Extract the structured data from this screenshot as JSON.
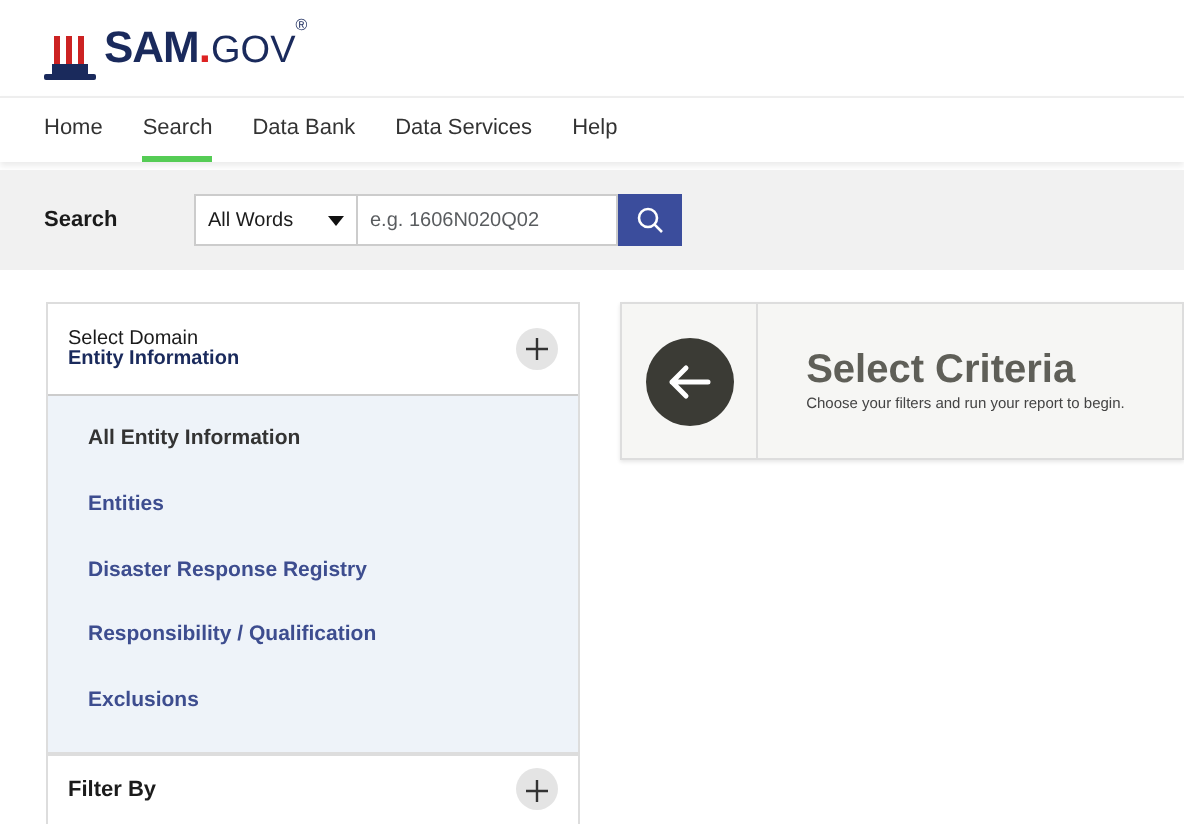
{
  "logo": {
    "name": "SAM",
    "dot": ".",
    "suffix": "GOV",
    "mark": "®"
  },
  "nav": [
    {
      "label": "Home",
      "selected": false
    },
    {
      "label": "Search",
      "selected": true
    },
    {
      "label": "Data Bank",
      "selected": false
    },
    {
      "label": "Data Services",
      "selected": false
    },
    {
      "label": "Help",
      "selected": false
    }
  ],
  "search": {
    "label": "Search",
    "scope": "All Words",
    "placeholder": "e.g. 1606N020Q02"
  },
  "domain": {
    "label": "Select Domain",
    "value": "Entity Information",
    "items": [
      {
        "label": "All Entity Information",
        "selected": true
      },
      {
        "label": "Entities",
        "selected": false
      },
      {
        "label": "Disaster Response Registry",
        "selected": false
      },
      {
        "label": "Responsibility / Qualification",
        "selected": false
      },
      {
        "label": "Exclusions",
        "selected": false
      }
    ]
  },
  "filter": {
    "label": "Filter By"
  },
  "criteria": {
    "title": "Select Criteria",
    "subtitle": "Choose your filters and run your report to begin."
  }
}
